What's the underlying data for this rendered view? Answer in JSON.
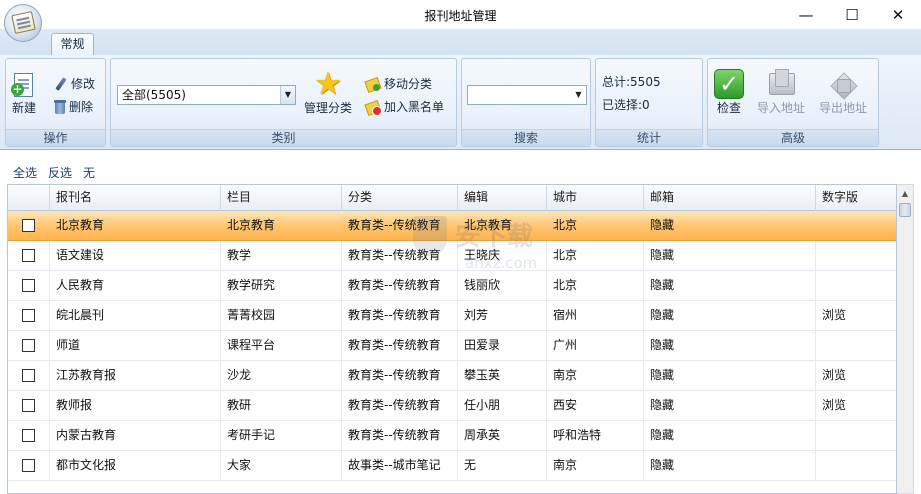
{
  "window": {
    "title": "报刊地址管理"
  },
  "tabs": [
    {
      "label": "常规"
    }
  ],
  "ribbon": {
    "groups": {
      "operations": {
        "label": "操作",
        "new_label": "新建",
        "edit_label": "修改",
        "delete_label": "删除"
      },
      "category": {
        "label": "类别",
        "combo_value": "全部(5505)",
        "manage_label": "管理分类",
        "move_label": "移动分类",
        "blacklist_label": "加入黑名单"
      },
      "search": {
        "label": "搜索",
        "combo_value": ""
      },
      "stats": {
        "label": "统计",
        "total_text": "总计:5505",
        "selected_text": "已选择:0"
      },
      "advanced": {
        "label": "高级",
        "check_label": "检查",
        "import_label": "导入地址",
        "export_label": "导出地址"
      }
    }
  },
  "selection": {
    "select_all": "全选",
    "invert": "反选",
    "none": "无"
  },
  "table": {
    "columns": [
      "",
      "报刊名",
      "栏目",
      "分类",
      "编辑",
      "城市",
      "邮箱",
      "数字版"
    ],
    "selected_row": 0,
    "rows": [
      {
        "name": "北京教育",
        "column": "北京教育",
        "category": "教育类--传统教育",
        "editor": "北京教育",
        "city": "北京",
        "email": "隐藏",
        "digital": ""
      },
      {
        "name": "语文建设",
        "column": "教学",
        "category": "教育类--传统教育",
        "editor": "王晓庆",
        "city": "北京",
        "email": "隐藏",
        "digital": ""
      },
      {
        "name": "人民教育",
        "column": "教学研究",
        "category": "教育类--传统教育",
        "editor": "钱丽欣",
        "city": "北京",
        "email": "隐藏",
        "digital": ""
      },
      {
        "name": "皖北晨刊",
        "column": "菁菁校园",
        "category": "教育类--传统教育",
        "editor": "刘芳",
        "city": "宿州",
        "email": "隐藏",
        "digital": "浏览"
      },
      {
        "name": "师道",
        "column": "课程平台",
        "category": "教育类--传统教育",
        "editor": "田爱录",
        "city": "广州",
        "email": "隐藏",
        "digital": ""
      },
      {
        "name": "江苏教育报",
        "column": "沙龙",
        "category": "教育类--传统教育",
        "editor": "攀玉英",
        "city": "南京",
        "email": "隐藏",
        "digital": "浏览"
      },
      {
        "name": "教师报",
        "column": "教研",
        "category": "教育类--传统教育",
        "editor": "任小朋",
        "city": "西安",
        "email": "隐藏",
        "digital": "浏览"
      },
      {
        "name": "内蒙古教育",
        "column": "考研手记",
        "category": "教育类--传统教育",
        "editor": "周承英",
        "city": "呼和浩特",
        "email": "隐藏",
        "digital": ""
      },
      {
        "name": "都市文化报",
        "column": "大家",
        "category": "故事类--城市笔记",
        "editor": "无",
        "city": "南京",
        "email": "隐藏",
        "digital": ""
      }
    ]
  },
  "watermark": {
    "text": "安下载",
    "sub": "anxz.com"
  },
  "colors": {
    "selected_row": "#ffc672",
    "ribbon_bg": "#dde8f5",
    "check_green": "#2f9a2c",
    "star_yellow": "#f5c518"
  }
}
